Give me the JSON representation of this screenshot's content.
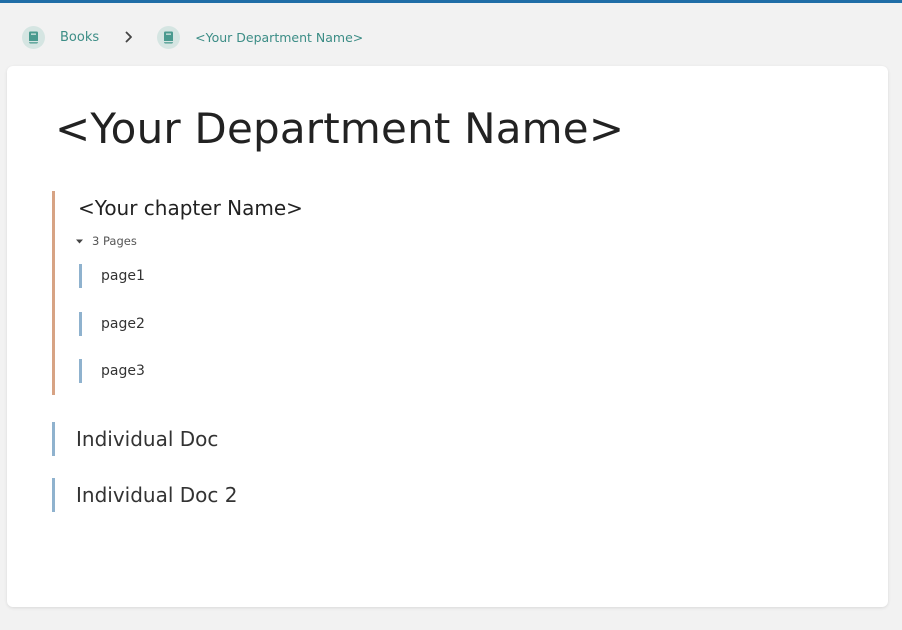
{
  "breadcrumb": {
    "items": [
      {
        "label": "Books",
        "icon": "book-icon"
      },
      {
        "label": "<Your Department Name>",
        "icon": "book-icon"
      }
    ],
    "separator_icon": "chevron-right-icon"
  },
  "main": {
    "title": "<Your Department Name>",
    "chapter": {
      "name": "<Your chapter Name>",
      "pages_toggle": "3 Pages",
      "pages": [
        {
          "label": "page1"
        },
        {
          "label": "page2"
        },
        {
          "label": "page3"
        }
      ]
    },
    "documents": [
      {
        "label": "Individual Doc"
      },
      {
        "label": "Individual Doc 2"
      }
    ]
  },
  "colors": {
    "top_bar": "#206ea7",
    "breadcrumb_link": "#3c8d86",
    "chapter_accent": "#d7a384",
    "page_accent": "#8fb2ce",
    "background": "#f2f2f2",
    "card": "#ffffff"
  }
}
